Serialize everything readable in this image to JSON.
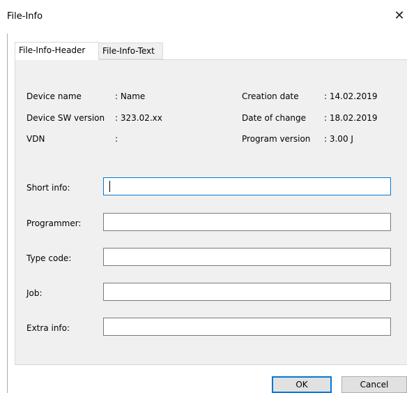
{
  "window": {
    "title": "File-Info",
    "close_glyph": "✕"
  },
  "tabs": [
    {
      "label": "File-Info-Header",
      "active": true
    },
    {
      "label": "File-Info-Text",
      "active": false
    }
  ],
  "info": {
    "device_name_label": "Device name",
    "device_name_value": ": Name",
    "device_sw_label": "Device SW version",
    "device_sw_value": ": 323.02.xx",
    "vdn_label": "VDN",
    "vdn_value": ":",
    "creation_date_label": "Creation date",
    "creation_date_value": ": 14.02.2019",
    "date_of_change_label": "Date of change",
    "date_of_change_value": ": 18.02.2019",
    "program_version_label": "Program version",
    "program_version_value": ": 3.00 J"
  },
  "fields": {
    "short_info": {
      "label": "Short info:",
      "value": ""
    },
    "programmer": {
      "label": "Programmer:",
      "value": ""
    },
    "type_code": {
      "label": "Type code:",
      "value": ""
    },
    "job": {
      "label": "Job:",
      "value": ""
    },
    "extra_info": {
      "label": "Extra info:",
      "value": ""
    }
  },
  "buttons": {
    "ok": "OK",
    "cancel": "Cancel"
  },
  "colors": {
    "accent": "#0078d7",
    "panel_bg": "#f0f0f0",
    "button_bg": "#e1e1e1"
  }
}
